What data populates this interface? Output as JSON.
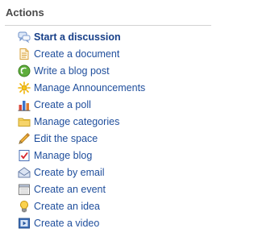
{
  "panel": {
    "title": "Actions"
  },
  "actions": [
    {
      "label": "Start a discussion",
      "icon": "discussion-icon"
    },
    {
      "label": "Create a document",
      "icon": "document-icon"
    },
    {
      "label": "Write a blog post",
      "icon": "blog-post-icon"
    },
    {
      "label": "Manage Announcements",
      "icon": "announcement-icon"
    },
    {
      "label": "Create a poll",
      "icon": "poll-icon"
    },
    {
      "label": "Manage categories",
      "icon": "folder-icon"
    },
    {
      "label": "Edit the space",
      "icon": "pencil-icon"
    },
    {
      "label": "Manage blog",
      "icon": "blog-manage-icon"
    },
    {
      "label": "Create by email",
      "icon": "email-icon"
    },
    {
      "label": "Create an event",
      "icon": "calendar-icon"
    },
    {
      "label": "Create an idea",
      "icon": "lightbulb-icon"
    },
    {
      "label": "Create a video",
      "icon": "video-icon"
    }
  ],
  "colors": {
    "link": "#1f4e9c",
    "title": "#4a4a4a",
    "divider": "#d3d3d3"
  }
}
